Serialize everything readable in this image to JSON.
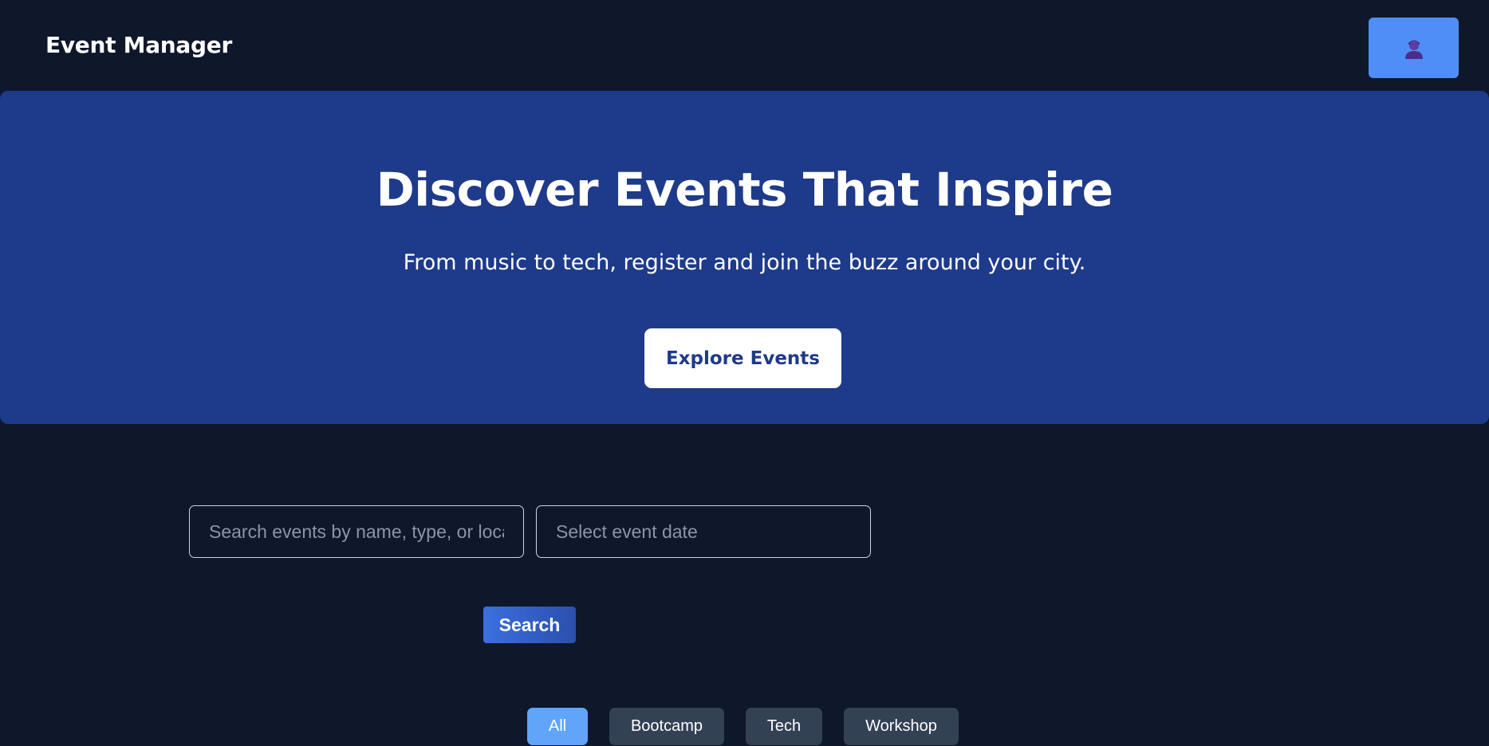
{
  "header": {
    "brand": "Event Manager",
    "profile_icon": "user-avatar-icon",
    "profile_button_color": "#4f8ef7"
  },
  "hero": {
    "title": "Discover Events That Inspire",
    "subtitle": "From music to tech, register and join the buzz around your city.",
    "cta_label": "Explore Events",
    "background_color": "#1e3a8a"
  },
  "search": {
    "query_placeholder": "Search events by name, type, or location",
    "query_value": "",
    "date_placeholder": "Select event date",
    "date_value": "",
    "button_label": "Search"
  },
  "filters": {
    "active": "All",
    "items": [
      {
        "label": "All",
        "active": true
      },
      {
        "label": "Bootcamp",
        "active": false
      },
      {
        "label": "Tech",
        "active": false
      },
      {
        "label": "Workshop",
        "active": false
      }
    ]
  },
  "colors": {
    "page_background": "#0f172a",
    "chip_active": "#60a5fa",
    "chip_inactive": "#334155"
  }
}
